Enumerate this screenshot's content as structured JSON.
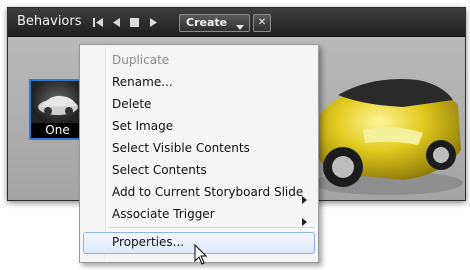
{
  "panel": {
    "title": "Behaviors",
    "create_label": "Create",
    "close_glyph": "✕",
    "thumbnail_label": "One"
  },
  "menu": {
    "items": [
      {
        "label": "Duplicate",
        "disabled": true,
        "submenu": false
      },
      {
        "label": "Rename...",
        "disabled": false,
        "submenu": false
      },
      {
        "label": "Delete",
        "disabled": false,
        "submenu": false
      },
      {
        "label": "Set Image",
        "disabled": false,
        "submenu": false
      },
      {
        "label": "Select Visible Contents",
        "disabled": false,
        "submenu": false
      },
      {
        "label": "Select Contents",
        "disabled": false,
        "submenu": false
      },
      {
        "label": "Add to Current Storyboard Slide",
        "disabled": false,
        "submenu": true
      },
      {
        "label": "Associate Trigger",
        "disabled": false,
        "submenu": true
      },
      {
        "label": "Properties...",
        "disabled": false,
        "submenu": false,
        "hovered": true
      }
    ]
  },
  "icons": [
    "skip-to-start-icon",
    "step-back-icon",
    "stop-icon",
    "play-icon",
    "chevron-down-icon",
    "close-icon",
    "submenu-arrow-icon",
    "mouse-pointer-icon"
  ],
  "colors": {
    "selection_border": "#2e7bd6",
    "car_body": "#d9c21a"
  }
}
